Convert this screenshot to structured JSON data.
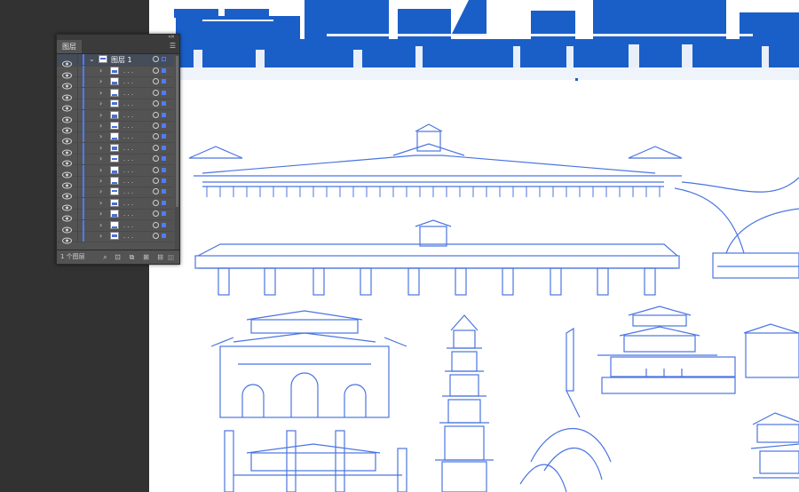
{
  "panel": {
    "tab_label": "图层",
    "menu_icon": "menu-icon",
    "collapse_icon": "collapse-icon",
    "footer": {
      "layer_count": "1 个图层"
    }
  },
  "layers": {
    "parent": {
      "name": "图层 1"
    },
    "children": [
      {
        "name": ". . ."
      },
      {
        "name": ". . ."
      },
      {
        "name": ". . ."
      },
      {
        "name": ". . ."
      },
      {
        "name": ". . ."
      },
      {
        "name": ". . ."
      },
      {
        "name": ". . ."
      },
      {
        "name": ". . ."
      },
      {
        "name": ". . ."
      },
      {
        "name": ". . ."
      },
      {
        "name": ". . ."
      },
      {
        "name": ". . ."
      },
      {
        "name": ". . ."
      },
      {
        "name": ". . ."
      },
      {
        "name": ". . ."
      },
      {
        "name": ". . ."
      }
    ]
  },
  "artboard": {
    "illustration_color": "#4a74e0",
    "banner_color": "#1a5fc8"
  }
}
